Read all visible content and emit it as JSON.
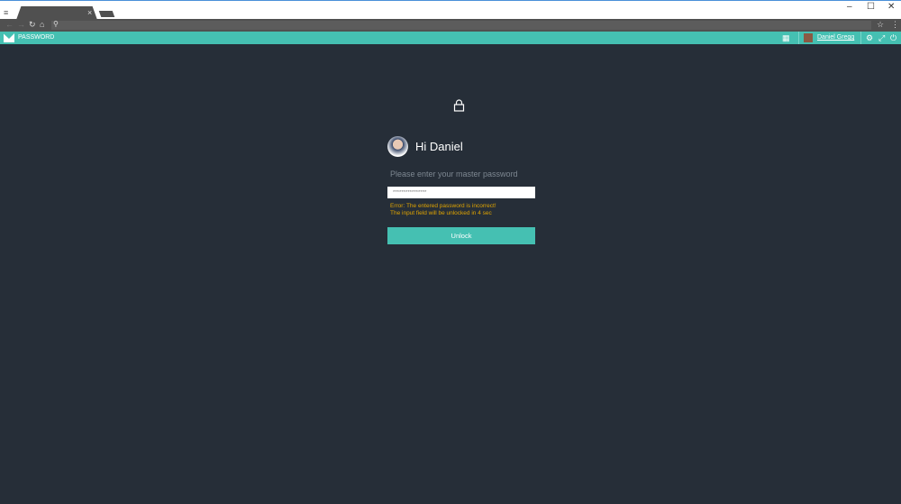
{
  "browser": {
    "tab_close": "×",
    "minimize": "–",
    "maximize": "☐",
    "close": "✕"
  },
  "app": {
    "title": "PASSWORD",
    "user_name": "Daniel Gregg"
  },
  "login": {
    "greeting": "Hi Daniel",
    "prompt": "Please enter your master password",
    "password_value": "****************",
    "error_line1": "Error: The entered password is incorrect!",
    "error_line2": "The input field will be unlocked in 4 sec",
    "unlock_label": "Unlock"
  },
  "colors": {
    "accent": "#45c0b2",
    "background": "#262e38",
    "error": "#e0a400"
  }
}
